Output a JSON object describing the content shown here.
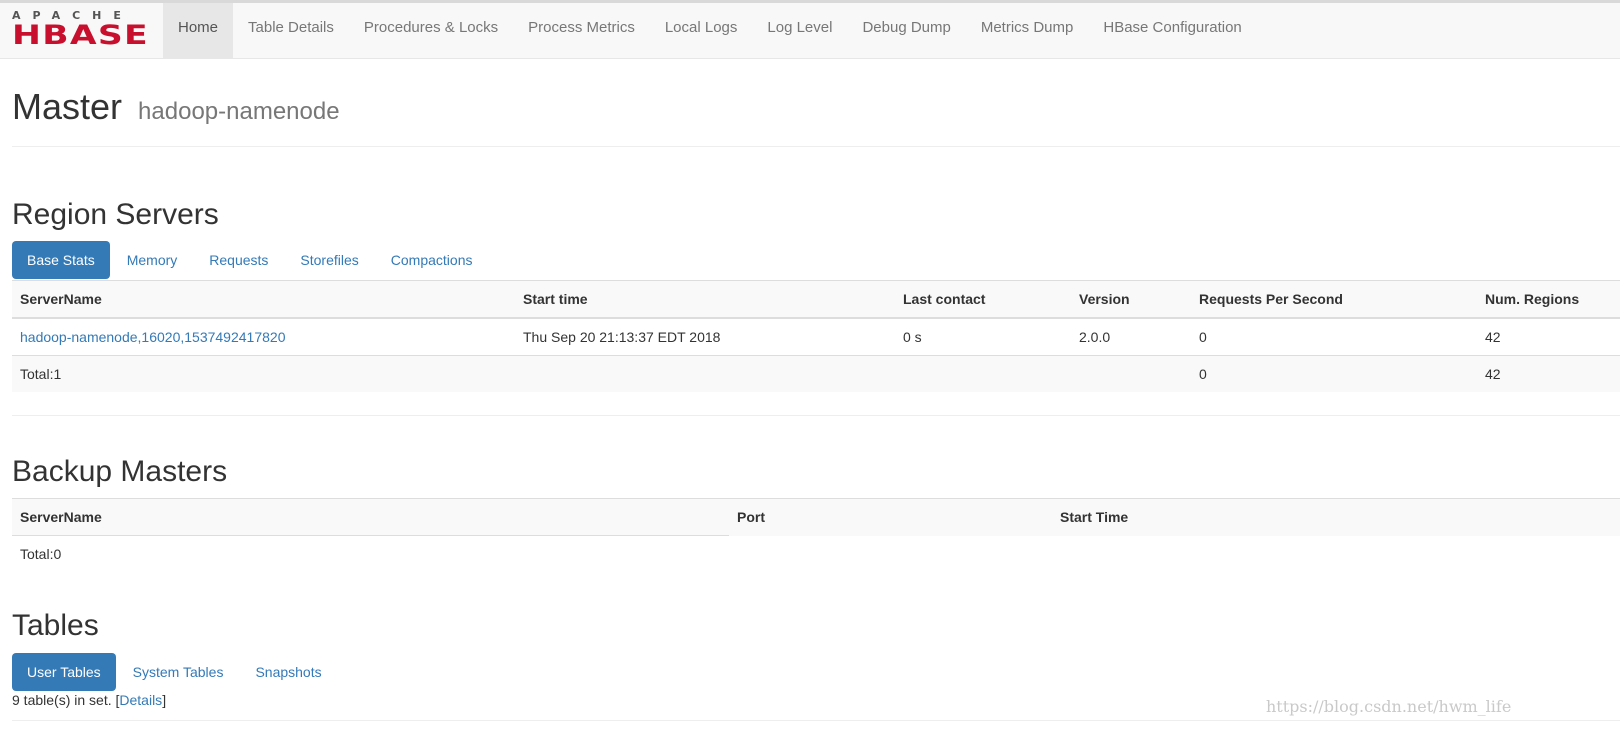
{
  "brand": {
    "apache": "APACHE",
    "hbase": "HBASE",
    "color": "#c8102e"
  },
  "nav": {
    "items": [
      "Home",
      "Table Details",
      "Procedures & Locks",
      "Process Metrics",
      "Local Logs",
      "Log Level",
      "Debug Dump",
      "Metrics Dump",
      "HBase Configuration"
    ],
    "active": "Home"
  },
  "header": {
    "title": "Master",
    "host": "hadoop-namenode"
  },
  "region_servers": {
    "heading": "Region Servers",
    "tabs": [
      "Base Stats",
      "Memory",
      "Requests",
      "Storefiles",
      "Compactions"
    ],
    "active_tab": "Base Stats",
    "columns": [
      "ServerName",
      "Start time",
      "Last contact",
      "Version",
      "Requests Per Second",
      "Num. Regions"
    ],
    "row": {
      "server": "hadoop-namenode,16020,1537492417820",
      "start_time": "Thu Sep 20 21:13:37 EDT 2018",
      "last_contact": "0 s",
      "version": "2.0.0",
      "rps": "0",
      "regions": "42"
    },
    "total": {
      "label": "Total:1",
      "rps": "0",
      "regions": "42"
    }
  },
  "backup_masters": {
    "heading": "Backup Masters",
    "columns": [
      "ServerName",
      "Port",
      "Start Time"
    ],
    "total": "Total:0"
  },
  "tables": {
    "heading": "Tables",
    "tabs": [
      "User Tables",
      "System Tables",
      "Snapshots"
    ],
    "active_tab": "User Tables",
    "info_prefix": "9 table(s) in set. [",
    "details_link": "Details",
    "info_suffix": "]"
  },
  "watermark": "https://blog.csdn.net/hwm_life",
  "colors": {
    "link": "#337ab7",
    "active_pill": "#337ab7",
    "navbar_bg": "#f8f8f8"
  }
}
